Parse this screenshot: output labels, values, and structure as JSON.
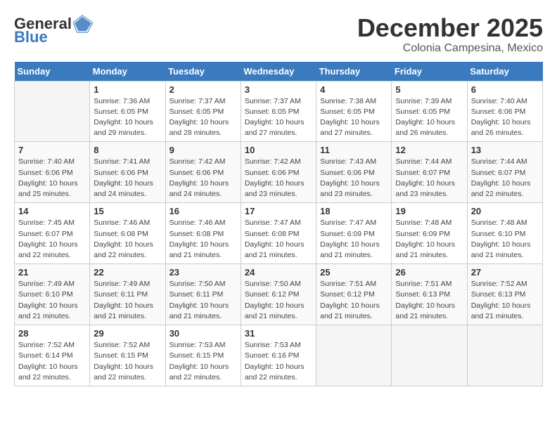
{
  "header": {
    "logo_general": "General",
    "logo_blue": "Blue",
    "month": "December 2025",
    "location": "Colonia Campesina, Mexico"
  },
  "weekdays": [
    "Sunday",
    "Monday",
    "Tuesday",
    "Wednesday",
    "Thursday",
    "Friday",
    "Saturday"
  ],
  "weeks": [
    [
      {
        "day": "",
        "detail": ""
      },
      {
        "day": "1",
        "detail": "Sunrise: 7:36 AM\nSunset: 6:05 PM\nDaylight: 10 hours\nand 29 minutes."
      },
      {
        "day": "2",
        "detail": "Sunrise: 7:37 AM\nSunset: 6:05 PM\nDaylight: 10 hours\nand 28 minutes."
      },
      {
        "day": "3",
        "detail": "Sunrise: 7:37 AM\nSunset: 6:05 PM\nDaylight: 10 hours\nand 27 minutes."
      },
      {
        "day": "4",
        "detail": "Sunrise: 7:38 AM\nSunset: 6:05 PM\nDaylight: 10 hours\nand 27 minutes."
      },
      {
        "day": "5",
        "detail": "Sunrise: 7:39 AM\nSunset: 6:05 PM\nDaylight: 10 hours\nand 26 minutes."
      },
      {
        "day": "6",
        "detail": "Sunrise: 7:40 AM\nSunset: 6:06 PM\nDaylight: 10 hours\nand 26 minutes."
      }
    ],
    [
      {
        "day": "7",
        "detail": "Sunrise: 7:40 AM\nSunset: 6:06 PM\nDaylight: 10 hours\nand 25 minutes."
      },
      {
        "day": "8",
        "detail": "Sunrise: 7:41 AM\nSunset: 6:06 PM\nDaylight: 10 hours\nand 24 minutes."
      },
      {
        "day": "9",
        "detail": "Sunrise: 7:42 AM\nSunset: 6:06 PM\nDaylight: 10 hours\nand 24 minutes."
      },
      {
        "day": "10",
        "detail": "Sunrise: 7:42 AM\nSunset: 6:06 PM\nDaylight: 10 hours\nand 23 minutes."
      },
      {
        "day": "11",
        "detail": "Sunrise: 7:43 AM\nSunset: 6:06 PM\nDaylight: 10 hours\nand 23 minutes."
      },
      {
        "day": "12",
        "detail": "Sunrise: 7:44 AM\nSunset: 6:07 PM\nDaylight: 10 hours\nand 23 minutes."
      },
      {
        "day": "13",
        "detail": "Sunrise: 7:44 AM\nSunset: 6:07 PM\nDaylight: 10 hours\nand 22 minutes."
      }
    ],
    [
      {
        "day": "14",
        "detail": "Sunrise: 7:45 AM\nSunset: 6:07 PM\nDaylight: 10 hours\nand 22 minutes."
      },
      {
        "day": "15",
        "detail": "Sunrise: 7:46 AM\nSunset: 6:08 PM\nDaylight: 10 hours\nand 22 minutes."
      },
      {
        "day": "16",
        "detail": "Sunrise: 7:46 AM\nSunset: 6:08 PM\nDaylight: 10 hours\nand 21 minutes."
      },
      {
        "day": "17",
        "detail": "Sunrise: 7:47 AM\nSunset: 6:08 PM\nDaylight: 10 hours\nand 21 minutes."
      },
      {
        "day": "18",
        "detail": "Sunrise: 7:47 AM\nSunset: 6:09 PM\nDaylight: 10 hours\nand 21 minutes."
      },
      {
        "day": "19",
        "detail": "Sunrise: 7:48 AM\nSunset: 6:09 PM\nDaylight: 10 hours\nand 21 minutes."
      },
      {
        "day": "20",
        "detail": "Sunrise: 7:48 AM\nSunset: 6:10 PM\nDaylight: 10 hours\nand 21 minutes."
      }
    ],
    [
      {
        "day": "21",
        "detail": "Sunrise: 7:49 AM\nSunset: 6:10 PM\nDaylight: 10 hours\nand 21 minutes."
      },
      {
        "day": "22",
        "detail": "Sunrise: 7:49 AM\nSunset: 6:11 PM\nDaylight: 10 hours\nand 21 minutes."
      },
      {
        "day": "23",
        "detail": "Sunrise: 7:50 AM\nSunset: 6:11 PM\nDaylight: 10 hours\nand 21 minutes."
      },
      {
        "day": "24",
        "detail": "Sunrise: 7:50 AM\nSunset: 6:12 PM\nDaylight: 10 hours\nand 21 minutes."
      },
      {
        "day": "25",
        "detail": "Sunrise: 7:51 AM\nSunset: 6:12 PM\nDaylight: 10 hours\nand 21 minutes."
      },
      {
        "day": "26",
        "detail": "Sunrise: 7:51 AM\nSunset: 6:13 PM\nDaylight: 10 hours\nand 21 minutes."
      },
      {
        "day": "27",
        "detail": "Sunrise: 7:52 AM\nSunset: 6:13 PM\nDaylight: 10 hours\nand 21 minutes."
      }
    ],
    [
      {
        "day": "28",
        "detail": "Sunrise: 7:52 AM\nSunset: 6:14 PM\nDaylight: 10 hours\nand 22 minutes."
      },
      {
        "day": "29",
        "detail": "Sunrise: 7:52 AM\nSunset: 6:15 PM\nDaylight: 10 hours\nand 22 minutes."
      },
      {
        "day": "30",
        "detail": "Sunrise: 7:53 AM\nSunset: 6:15 PM\nDaylight: 10 hours\nand 22 minutes."
      },
      {
        "day": "31",
        "detail": "Sunrise: 7:53 AM\nSunset: 6:16 PM\nDaylight: 10 hours\nand 22 minutes."
      },
      {
        "day": "",
        "detail": ""
      },
      {
        "day": "",
        "detail": ""
      },
      {
        "day": "",
        "detail": ""
      }
    ]
  ]
}
